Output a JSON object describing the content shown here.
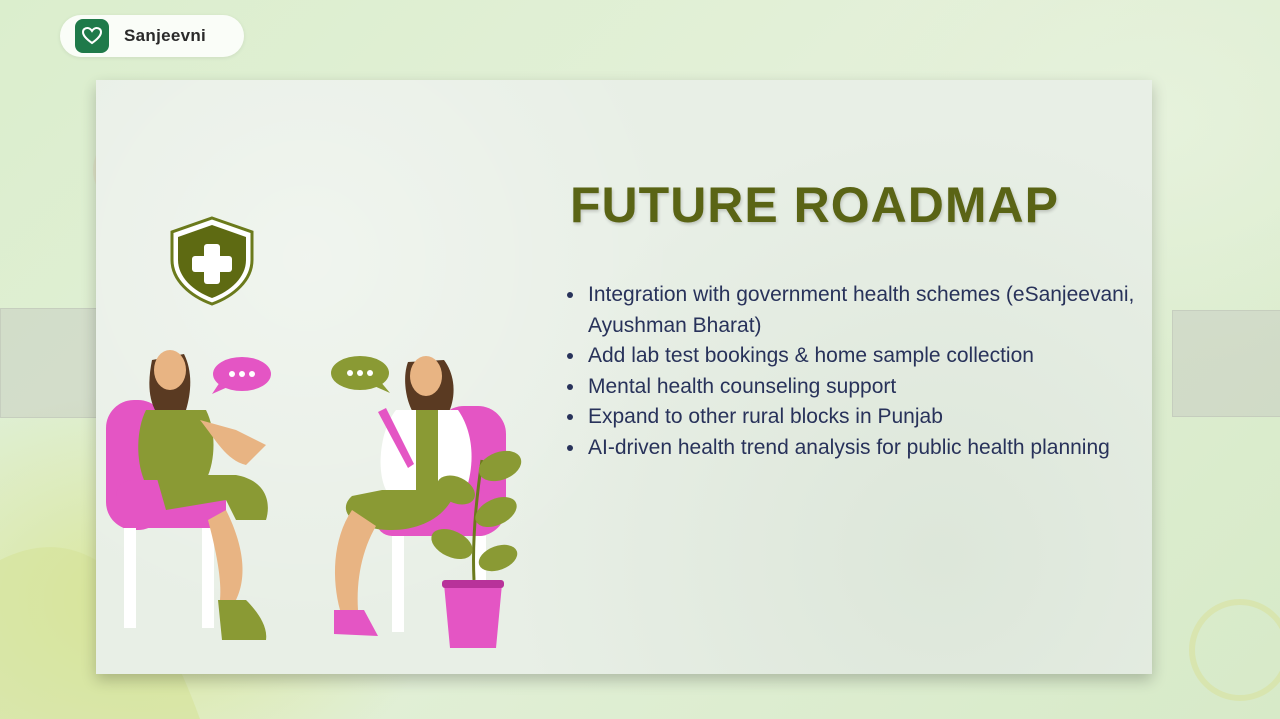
{
  "brand": {
    "name": "Sanjeevni",
    "icon": "heart-icon",
    "color": "#1f7a4a"
  },
  "slide": {
    "title": "FUTURE ROADMAP",
    "title_color": "#5a6415",
    "text_color": "#28325a",
    "bullets": [
      "Integration with government health schemes (eSanjeevani, Ayushman Bharat)",
      "Add lab test bookings & home sample collection",
      "Mental health counseling support",
      "Expand to other rural blocks in Punjab",
      "AI-driven health trend analysis for public health planning"
    ]
  },
  "illustration": {
    "shield_icon": "shield-medical-cross-icon",
    "chat_icons": [
      "speech-bubble-icon",
      "speech-bubble-icon"
    ],
    "accent_pink": "#e455c4",
    "accent_olive": "#8a9a34"
  }
}
